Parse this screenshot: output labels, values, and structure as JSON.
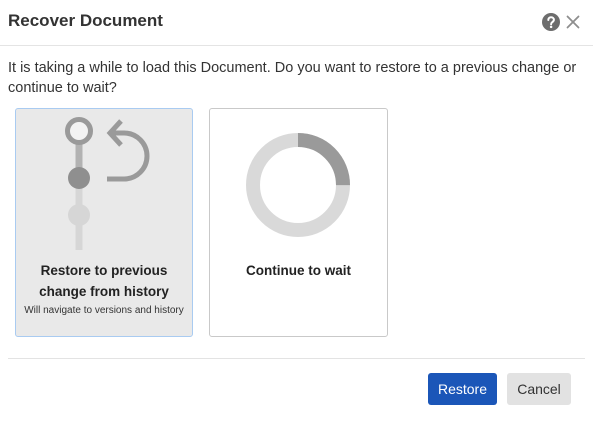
{
  "dialog": {
    "title": "Recover Document",
    "help_icon": "help-icon",
    "close_icon": "close-icon",
    "message": "It is taking a while to load this Document. Do you want to restore to a previous change or continue to wait?"
  },
  "options": [
    {
      "title": "Restore to previous change from history",
      "subtitle": "Will navigate to versions and history",
      "icon": "history-timeline-icon",
      "selected": true
    },
    {
      "title": "Continue to wait",
      "icon": "progress-donut-icon",
      "progress": 0.25,
      "selected": false
    }
  ],
  "buttons": {
    "restore": "Restore",
    "cancel": "Cancel"
  },
  "colors": {
    "primary_button": "#1b56b8",
    "secondary_button": "#e2e2e2",
    "selected_card_border": "#a9cbf1",
    "selected_card_bg": "#e9e9e9",
    "icon_gray": "#9a9a9a",
    "track_gray": "#d9d9d9"
  }
}
